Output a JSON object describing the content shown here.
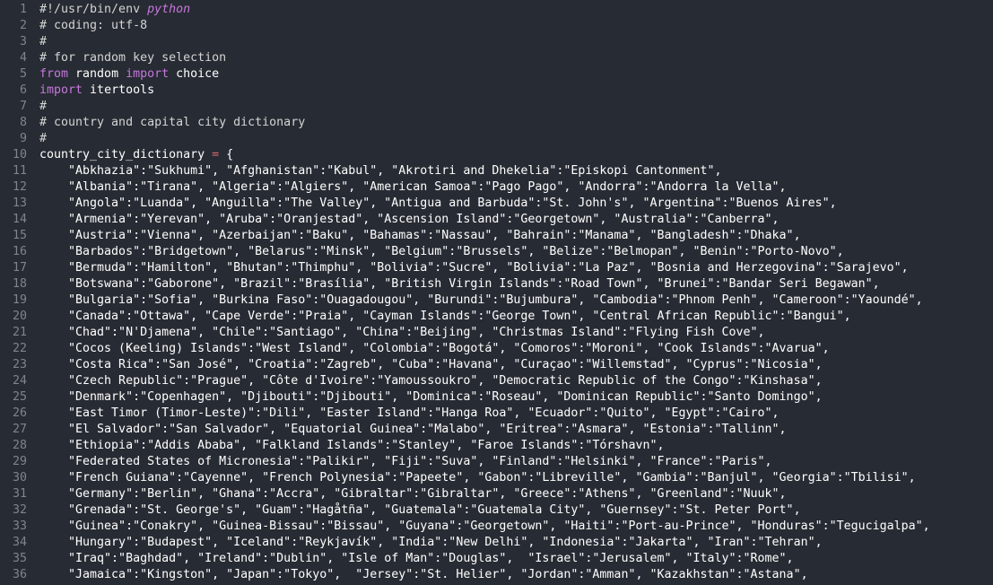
{
  "editor": {
    "lines": [
      {
        "n": "1",
        "parts": [
          {
            "t": "#!/usr/bin/env ",
            "c": "comment"
          },
          {
            "t": "python",
            "c": "it"
          }
        ]
      },
      {
        "n": "2",
        "parts": [
          {
            "t": "# coding: utf-8",
            "c": "comment"
          }
        ]
      },
      {
        "n": "3",
        "parts": [
          {
            "t": "#",
            "c": "comment"
          }
        ]
      },
      {
        "n": "4",
        "parts": [
          {
            "t": "# for random key selection",
            "c": "comment"
          }
        ]
      },
      {
        "n": "5",
        "parts": [
          {
            "t": "from",
            "c": "kw"
          },
          {
            "t": " random ",
            "c": "str"
          },
          {
            "t": "import",
            "c": "kw"
          },
          {
            "t": " choice",
            "c": "str"
          }
        ]
      },
      {
        "n": "6",
        "parts": [
          {
            "t": "import",
            "c": "kw"
          },
          {
            "t": " itertools",
            "c": "str"
          }
        ]
      },
      {
        "n": "7",
        "parts": [
          {
            "t": "#",
            "c": "comment"
          }
        ]
      },
      {
        "n": "8",
        "parts": [
          {
            "t": "# country and capital city dictionary",
            "c": "comment"
          }
        ]
      },
      {
        "n": "9",
        "parts": [
          {
            "t": "#",
            "c": "comment"
          }
        ]
      },
      {
        "n": "10",
        "parts": [
          {
            "t": "country_city_dictionary ",
            "c": "str"
          },
          {
            "t": "=",
            "c": "op"
          },
          {
            "t": " {",
            "c": "str"
          }
        ]
      },
      {
        "n": "11",
        "parts": [
          {
            "t": "    \"Abkhazia\":\"Sukhumi\", \"Afghanistan\":\"Kabul\", \"Akrotiri and Dhekelia\":\"Episkopi Cantonment\",",
            "c": "str"
          }
        ]
      },
      {
        "n": "12",
        "parts": [
          {
            "t": "    \"Albania\":\"Tirana\", \"Algeria\":\"Algiers\", \"American Samoa\":\"Pago Pago\", \"Andorra\":\"Andorra la Vella\",",
            "c": "str"
          }
        ]
      },
      {
        "n": "13",
        "parts": [
          {
            "t": "    \"Angola\":\"Luanda\", \"Anguilla\":\"The Valley\", \"Antigua and Barbuda\":\"St. John's\", \"Argentina\":\"Buenos Aires\",",
            "c": "str"
          }
        ]
      },
      {
        "n": "14",
        "parts": [
          {
            "t": "    \"Armenia\":\"Yerevan\", \"Aruba\":\"Oranjestad\", \"Ascension Island\":\"Georgetown\", \"Australia\":\"Canberra\",",
            "c": "str"
          }
        ]
      },
      {
        "n": "15",
        "parts": [
          {
            "t": "    \"Austria\":\"Vienna\", \"Azerbaijan\":\"Baku\", \"Bahamas\":\"Nassau\", \"Bahrain\":\"Manama\", \"Bangladesh\":\"Dhaka\",",
            "c": "str"
          }
        ]
      },
      {
        "n": "16",
        "parts": [
          {
            "t": "    \"Barbados\":\"Bridgetown\", \"Belarus\":\"Minsk\", \"Belgium\":\"Brussels\", \"Belize\":\"Belmopan\", \"Benin\":\"Porto-Novo\",",
            "c": "str"
          }
        ]
      },
      {
        "n": "17",
        "parts": [
          {
            "t": "    \"Bermuda\":\"Hamilton\", \"Bhutan\":\"Thimphu\", \"Bolivia\":\"Sucre\", \"Bolivia\":\"La Paz\", \"Bosnia and Herzegovina\":\"Sarajevo\",",
            "c": "str"
          }
        ]
      },
      {
        "n": "18",
        "parts": [
          {
            "t": "    \"Botswana\":\"Gaborone\", \"Brazil\":\"Brasília\", \"British Virgin Islands\":\"Road Town\", \"Brunei\":\"Bandar Seri Begawan\",",
            "c": "str"
          }
        ]
      },
      {
        "n": "19",
        "parts": [
          {
            "t": "    \"Bulgaria\":\"Sofia\", \"Burkina Faso\":\"Ouagadougou\", \"Burundi\":\"Bujumbura\", \"Cambodia\":\"Phnom Penh\", \"Cameroon\":\"Yaoundé\",",
            "c": "str"
          }
        ]
      },
      {
        "n": "20",
        "parts": [
          {
            "t": "    \"Canada\":\"Ottawa\", \"Cape Verde\":\"Praia\", \"Cayman Islands\":\"George Town\", \"Central African Republic\":\"Bangui\",",
            "c": "str"
          }
        ]
      },
      {
        "n": "21",
        "parts": [
          {
            "t": "    \"Chad\":\"N'Djamena\", \"Chile\":\"Santiago\", \"China\":\"Beijing\", \"Christmas Island\":\"Flying Fish Cove\",",
            "c": "str"
          }
        ]
      },
      {
        "n": "22",
        "parts": [
          {
            "t": "    \"Cocos (Keeling) Islands\":\"West Island\", \"Colombia\":\"Bogotá\", \"Comoros\":\"Moroni\", \"Cook Islands\":\"Avarua\",",
            "c": "str"
          }
        ]
      },
      {
        "n": "23",
        "parts": [
          {
            "t": "    \"Costa Rica\":\"San José\", \"Croatia\":\"Zagreb\", \"Cuba\":\"Havana\", \"Curaçao\":\"Willemstad\", \"Cyprus\":\"Nicosia\",",
            "c": "str"
          }
        ]
      },
      {
        "n": "24",
        "parts": [
          {
            "t": "    \"Czech Republic\":\"Prague\", \"Côte d'Ivoire\":\"Yamoussoukro\", \"Democratic Republic of the Congo\":\"Kinshasa\",",
            "c": "str"
          }
        ]
      },
      {
        "n": "25",
        "parts": [
          {
            "t": "    \"Denmark\":\"Copenhagen\", \"Djibouti\":\"Djibouti\", \"Dominica\":\"Roseau\", \"Dominican Republic\":\"Santo Domingo\",",
            "c": "str"
          }
        ]
      },
      {
        "n": "26",
        "parts": [
          {
            "t": "    \"East Timor (Timor-Leste)\":\"Dili\", \"Easter Island\":\"Hanga Roa\", \"Ecuador\":\"Quito\", \"Egypt\":\"Cairo\",",
            "c": "str"
          }
        ]
      },
      {
        "n": "27",
        "parts": [
          {
            "t": "    \"El Salvador\":\"San Salvador\", \"Equatorial Guinea\":\"Malabo\", \"Eritrea\":\"Asmara\", \"Estonia\":\"Tallinn\",",
            "c": "str"
          }
        ]
      },
      {
        "n": "28",
        "parts": [
          {
            "t": "    \"Ethiopia\":\"Addis Ababa\", \"Falkland Islands\":\"Stanley\", \"Faroe Islands\":\"Tórshavn\",",
            "c": "str"
          }
        ]
      },
      {
        "n": "29",
        "parts": [
          {
            "t": "    \"Federated States of Micronesia\":\"Palikir\", \"Fiji\":\"Suva\", \"Finland\":\"Helsinki\", \"France\":\"Paris\",",
            "c": "str"
          }
        ]
      },
      {
        "n": "30",
        "parts": [
          {
            "t": "    \"French Guiana\":\"Cayenne\", \"French Polynesia\":\"Papeete\", \"Gabon\":\"Libreville\", \"Gambia\":\"Banjul\", \"Georgia\":\"Tbilisi\",",
            "c": "str"
          }
        ]
      },
      {
        "n": "31",
        "parts": [
          {
            "t": "    \"Germany\":\"Berlin\", \"Ghana\":\"Accra\", \"Gibraltar\":\"Gibraltar\", \"Greece\":\"Athens\", \"Greenland\":\"Nuuk\",",
            "c": "str"
          }
        ]
      },
      {
        "n": "32",
        "parts": [
          {
            "t": "    \"Grenada\":\"St. George's\", \"Guam\":\"Hagåtña\", \"Guatemala\":\"Guatemala City\", \"Guernsey\":\"St. Peter Port\",",
            "c": "str"
          }
        ]
      },
      {
        "n": "33",
        "parts": [
          {
            "t": "    \"Guinea\":\"Conakry\", \"Guinea-Bissau\":\"Bissau\", \"Guyana\":\"Georgetown\", \"Haiti\":\"Port-au-Prince\", \"Honduras\":\"Tegucigalpa\",",
            "c": "str"
          }
        ]
      },
      {
        "n": "34",
        "parts": [
          {
            "t": "    \"Hungary\":\"Budapest\", \"Iceland\":\"Reykjavík\", \"India\":\"New Delhi\", \"Indonesia\":\"Jakarta\", \"Iran\":\"Tehran\",",
            "c": "str"
          }
        ]
      },
      {
        "n": "35",
        "parts": [
          {
            "t": "    \"Iraq\":\"Baghdad\", \"Ireland\":\"Dublin\", \"Isle of Man\":\"Douglas\",  \"Israel\":\"Jerusalem\", \"Italy\":\"Rome\",",
            "c": "str"
          }
        ]
      },
      {
        "n": "36",
        "parts": [
          {
            "t": "    \"Jamaica\":\"Kingston\", \"Japan\":\"Tokyo\",  \"Jersey\":\"St. Helier\", \"Jordan\":\"Amman\", \"Kazakhstan\":\"Astana\",",
            "c": "str"
          }
        ]
      }
    ]
  }
}
